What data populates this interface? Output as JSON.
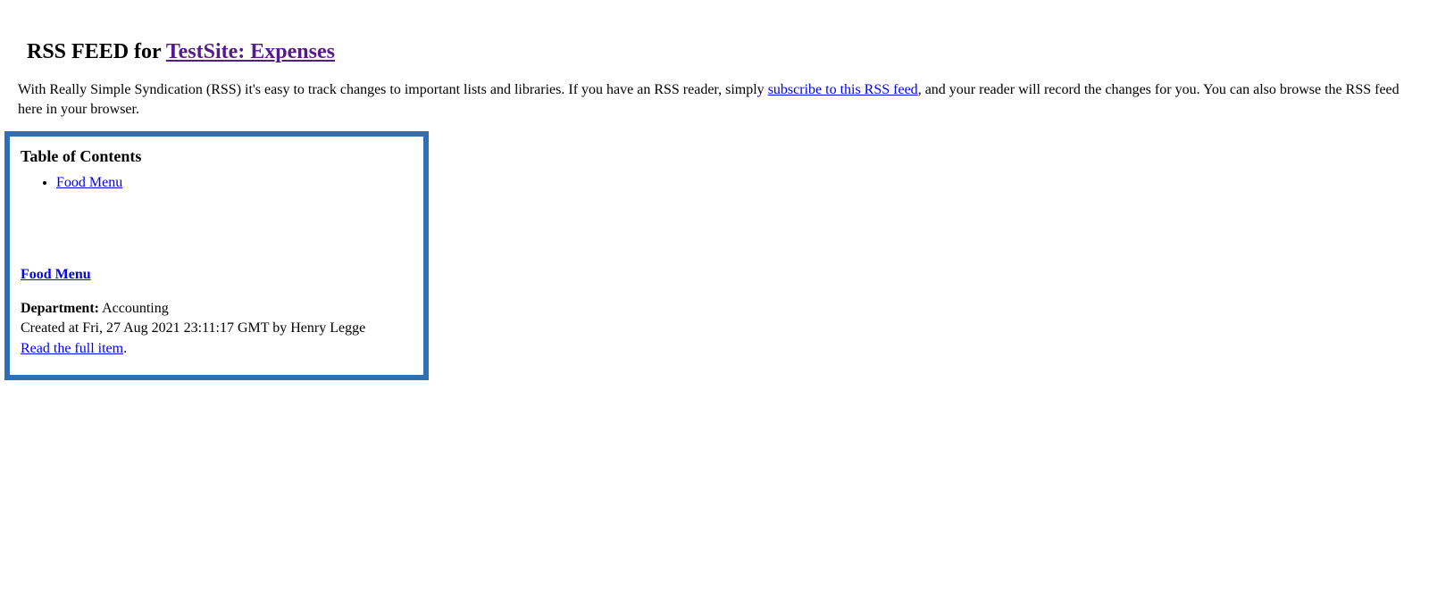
{
  "header": {
    "prefix": "RSS FEED for ",
    "site_link": "TestSite: Expenses"
  },
  "description": {
    "part1": "With Really Simple Syndication (RSS) it's easy to track changes to important lists and libraries. If you have an RSS reader, simply ",
    "subscribe_link": "subscribe to this RSS feed",
    "part2": ", and your reader will record the changes for you. You can also browse the RSS feed here in your browser."
  },
  "toc": {
    "title": "Table of Contents",
    "items": [
      {
        "label": "Food Menu"
      }
    ]
  },
  "item": {
    "title": "Food Menu",
    "department_label": "Department:",
    "department_value": " Accounting",
    "created_line": "Created at Fri, 27 Aug 2021 23:11:17 GMT by Henry Legge",
    "read_full": "Read the full item",
    "period": "."
  }
}
